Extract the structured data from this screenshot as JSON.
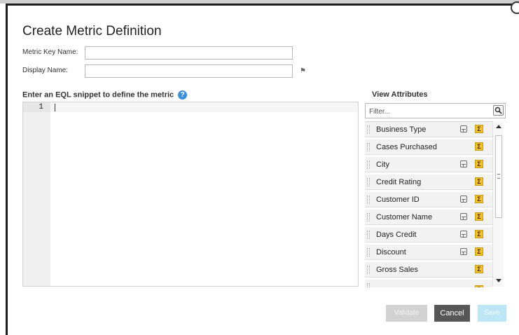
{
  "dialog": {
    "title": "Create Metric Definition"
  },
  "fields": {
    "metric_key_label": "Metric Key Name:",
    "metric_key_value": "",
    "display_name_label": "Display Name:",
    "display_name_value": ""
  },
  "editor": {
    "label": "Enter an EQL snippet to define the metric",
    "lines": [
      "1"
    ]
  },
  "attributes": {
    "heading": "View Attributes",
    "filter_placeholder": "Filter...",
    "items": [
      {
        "label": "Business Type",
        "dimension": true,
        "sum": true
      },
      {
        "label": "Cases Purchased",
        "dimension": false,
        "sum": true
      },
      {
        "label": "City",
        "dimension": true,
        "sum": true
      },
      {
        "label": "Credit Rating",
        "dimension": false,
        "sum": true
      },
      {
        "label": "Customer ID",
        "dimension": true,
        "sum": true
      },
      {
        "label": "Customer Name",
        "dimension": true,
        "sum": true
      },
      {
        "label": "Days Credit",
        "dimension": true,
        "sum": true
      },
      {
        "label": "Discount",
        "dimension": true,
        "sum": true
      },
      {
        "label": "Gross Sales",
        "dimension": false,
        "sum": true
      }
    ]
  },
  "buttons": {
    "validate": "Validate",
    "cancel": "Cancel",
    "save": "Save"
  },
  "colors": {
    "help_icon": "#3a8fd8",
    "sum_icon": "#f1c232",
    "cancel_button": "#575757",
    "save_button_disabled": "#bce6f4"
  }
}
